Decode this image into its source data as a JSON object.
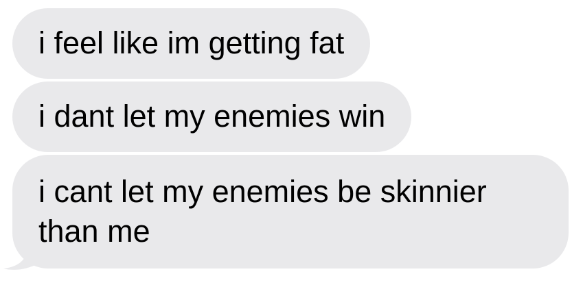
{
  "messages": [
    {
      "text": "i feel like im getting fat"
    },
    {
      "text": "i dant let my enemies win"
    },
    {
      "text": "i cant let my enemies be skinnier than me"
    }
  ],
  "colors": {
    "bubble_background": "#e9e9eb",
    "text": "#000000",
    "page_background": "#ffffff"
  }
}
